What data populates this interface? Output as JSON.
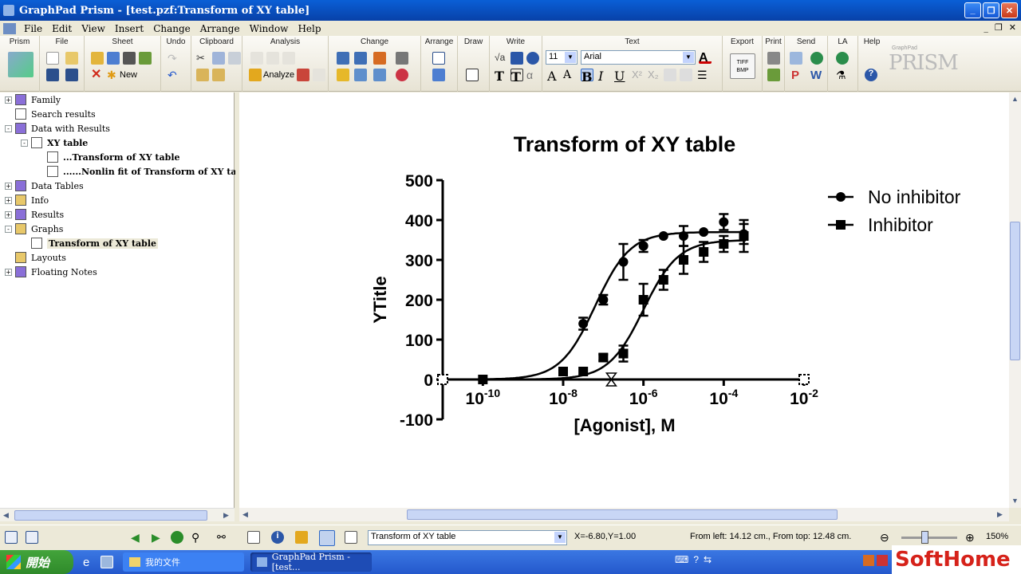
{
  "window": {
    "title": "GraphPad Prism - [test.pzf:Transform of XY table]"
  },
  "menu": [
    "File",
    "Edit",
    "View",
    "Insert",
    "Change",
    "Arrange",
    "Window",
    "Help"
  ],
  "toolbar": {
    "groups": [
      "Prism",
      "File",
      "Sheet",
      "Undo",
      "Clipboard",
      "Analysis",
      "Change",
      "Arrange",
      "Draw",
      "Write",
      "Text",
      "Export",
      "Print",
      "Send",
      "LA",
      "Help"
    ],
    "new_label": "New",
    "analyze_label": "Analyze",
    "font_size": "11",
    "font_name": "Arial",
    "export_tiff": "TIFF BMP",
    "logo_small": "GraphPad",
    "logo_big": "PRISM"
  },
  "tree": [
    {
      "label": "Family",
      "expander": "+",
      "indent": 0
    },
    {
      "label": "Search results",
      "expander": "",
      "indent": 0
    },
    {
      "label": "Data with Results",
      "expander": "-",
      "indent": 0
    },
    {
      "label": "XY table",
      "expander": "-",
      "indent": 1,
      "bold": true
    },
    {
      "label": "...Transform of XY table",
      "expander": "",
      "indent": 2,
      "bold": true
    },
    {
      "label": "......Nonlin fit of Transform of XY tal",
      "expander": "",
      "indent": 2,
      "bold": true
    },
    {
      "label": "Data Tables",
      "expander": "+",
      "indent": 0
    },
    {
      "label": "Info",
      "expander": "+",
      "indent": 0
    },
    {
      "label": "Results",
      "expander": "+",
      "indent": 0
    },
    {
      "label": "Graphs",
      "expander": "-",
      "indent": 0
    },
    {
      "label": "Transform of XY table",
      "expander": "",
      "indent": 1,
      "bold": true,
      "selected": true
    },
    {
      "label": "Layouts",
      "expander": "",
      "indent": 0
    },
    {
      "label": "Floating Notes",
      "expander": "+",
      "indent": 0
    }
  ],
  "chart_data": {
    "type": "scatter",
    "title": "Transform of XY table",
    "xlabel": "[Agonist], M",
    "ylabel": "YTitle",
    "xscale": "log",
    "xlim": [
      -11,
      -2
    ],
    "ylim": [
      -100,
      500
    ],
    "yticks": [
      -100,
      0,
      100,
      200,
      300,
      400,
      500
    ],
    "xticks": [
      -10,
      -8,
      -6,
      -4,
      -2
    ],
    "xtick_base": "10",
    "legend_position": "top-right",
    "series": [
      {
        "name": "No inhibitor",
        "marker": "circle",
        "x": [
          -10,
          -8,
          -7.5,
          -7,
          -6.5,
          -6,
          -5.5,
          -5,
          -4.5,
          -4,
          -3.5
        ],
        "y": [
          0,
          20,
          140,
          200,
          295,
          335,
          360,
          360,
          370,
          395,
          365
        ],
        "err": [
          0,
          0,
          15,
          12,
          45,
          15,
          0,
          25,
          0,
          20,
          25
        ],
        "fit": {
          "bottom": 0,
          "top": 370,
          "logec50": -7.2,
          "hill": 1
        }
      },
      {
        "name": "Inhibitor",
        "marker": "square",
        "x": [
          -10,
          -8,
          -7.5,
          -7,
          -6.5,
          -6,
          -5.5,
          -5,
          -4.5,
          -4,
          -3.5
        ],
        "y": [
          0,
          20,
          20,
          55,
          65,
          200,
          250,
          300,
          320,
          340,
          360
        ],
        "err": [
          0,
          0,
          0,
          8,
          20,
          40,
          25,
          35,
          25,
          20,
          40
        ],
        "fit": {
          "bottom": 0,
          "top": 350,
          "logec50": -6.0,
          "hill": 1
        }
      }
    ]
  },
  "status": {
    "sheet_select": "Transform of XY table",
    "coords": "X=-6.80,Y=1.00",
    "position": "From left: 14.12 cm., From top: 12.48 cm.",
    "zoom": "150%"
  },
  "taskbar": {
    "start": "開始",
    "items": [
      "我的文件",
      "GraphPad Prism - [test..."
    ],
    "watermark": "SoftHome"
  },
  "colors": {
    "accent": "#0841a8",
    "taskbar": "#2458cc",
    "start": "#3a9a33"
  }
}
